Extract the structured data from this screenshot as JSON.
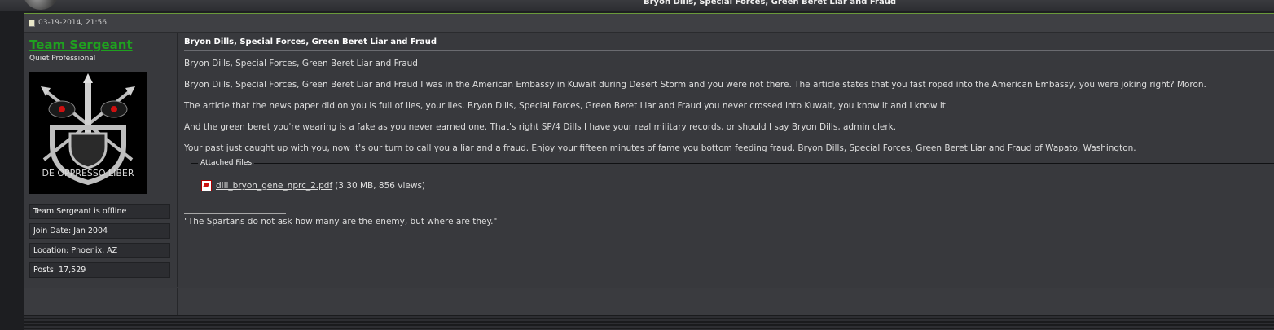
{
  "thread_title": "Bryon Dills, Special Forces, Green Beret Liar and Fraud",
  "post": {
    "date": "03-19-2014, 21:56",
    "title": "Bryon Dills, Special Forces, Green Beret Liar and Fraud",
    "paragraphs": [
      "Bryon Dills, Special Forces, Green Beret Liar and Fraud",
      "Bryon Dills, Special Forces, Green Beret Liar and Fraud I was in the American Embassy in Kuwait during Desert Storm and you were not there. The article states that you fast roped into the American Embassy, you were joking right? Moron.",
      "The article that the news paper did on you is full of lies, your lies. Bryon Dills, Special Forces, Green Beret Liar and Fraud you never crossed into Kuwait, you know it and I know it.",
      "And the green beret you're wearing is a fake as you never earned one. That's right SP/4 Dills I have your real military records, or should I say Bryon Dills, admin clerk.",
      "Your past just caught up with you, now it's our turn to call you a liar and a fraud. Enjoy your fifteen minutes of fame you bottom feeding fraud. Bryon Dills, Special Forces, Green Beret Liar and Fraud of Wapato, Washington."
    ],
    "attachments_label": "Attached Files",
    "attachment": {
      "filename": "dill_bryon_gene_nprc_2.pdf",
      "meta": "(3.30 MB, 856 views)"
    },
    "signature": "\"The Spartans do not ask how many are the enemy, but where are they.\""
  },
  "user": {
    "name": "Team Sergeant",
    "title": "Quiet Professional",
    "status": "Team Sergeant is offline",
    "join_date": "Join Date: Jan 2004",
    "location": "Location: Phoenix, AZ",
    "posts": "Posts: 17,529",
    "avatar_text": "DE OPPRESSO LIBER"
  },
  "colors": {
    "username": "#1fa11f",
    "background": "#38393d",
    "accent_line": "#6a9a3a"
  }
}
